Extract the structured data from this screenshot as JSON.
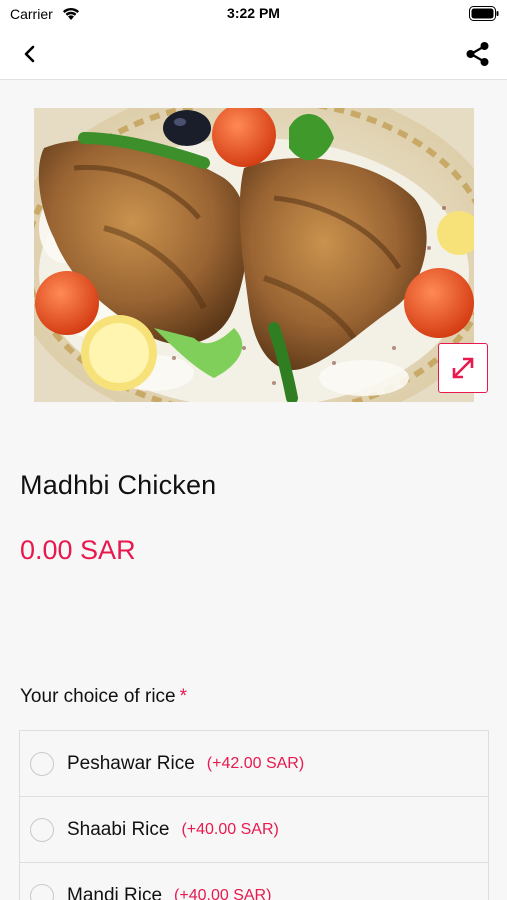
{
  "status_bar": {
    "carrier": "Carrier",
    "time": "3:22 PM"
  },
  "nav": {
    "back_icon": "chevron-left-icon",
    "share_icon": "share-icon"
  },
  "product": {
    "image_alt": "grilled chicken on rice",
    "expand_icon": "expand-arrows-icon",
    "name": "Madhbi Chicken",
    "price": "0.00 SAR"
  },
  "rice_choice": {
    "title": "Your choice of rice",
    "required_marker": "*",
    "options": [
      {
        "name": "Peshawar Rice",
        "extra": "(+42.00 SAR)"
      },
      {
        "name": "Shaabi Rice",
        "extra": "(+40.00 SAR)"
      },
      {
        "name": "Mandi Rice",
        "extra": "(+40.00 SAR)"
      }
    ]
  },
  "colors": {
    "accent": "#e8194e",
    "background": "#f7f7f7",
    "text": "#111111"
  }
}
